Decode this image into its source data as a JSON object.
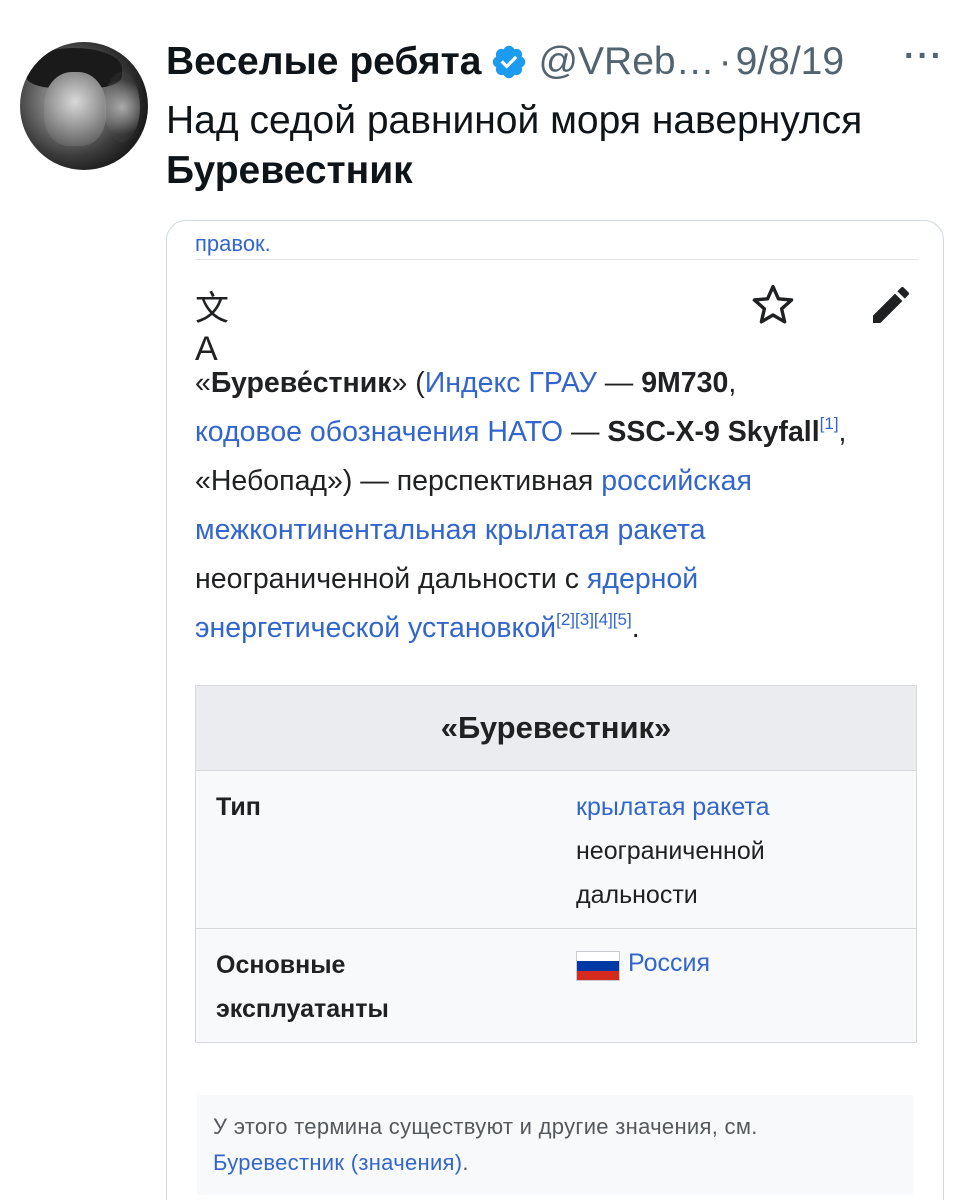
{
  "tweet": {
    "display_name": "Веселые ребята",
    "handle": "@VReb…",
    "separator": "·",
    "date": "9/8/19",
    "more": "···",
    "text_line": "Над седой равниной моря навернулся",
    "text_bold": "Буревестник"
  },
  "wiki": {
    "cut_text": "правок.",
    "translate_glyph": "文A",
    "article": {
      "p1_open": "«",
      "p1_title": "Буреве́стник",
      "p1_close": "» (",
      "gru_link": "Индекс ГРАУ",
      "dash1": " — ",
      "gru_code": "9М730",
      "comma1": ",",
      "nato_link": "кодовое обозначения НАТО",
      "dash2": " — ",
      "nato_code": "SSC-X-9 Skyfall",
      "ref1": "[1]",
      "comma2": ",",
      "alt_name": "«Небопад») — перспективная ",
      "russian_link": "российская",
      "icbm_link": "межконтинентальная крылатая ракета",
      "range_text": "неограниченной дальности с ",
      "nuclear_link_1": "ядерной",
      "nuclear_link_2": "энергетической установкой",
      "refs": "[2][3][4][5]",
      "period": "."
    },
    "infobox": {
      "title": "«Буревестник»",
      "type_label": "Тип",
      "type_value_link": "крылатая ракета",
      "type_value_line2": "неограниченной",
      "type_value_line3": "дальности",
      "operators_label_1": "Основные",
      "operators_label_2": "эксплуатанты",
      "operators_value": "Россия"
    },
    "hatnote": {
      "text": "У этого термина существуют и другие значения, см.",
      "link": "Буревестник (значения)",
      "period": "."
    }
  },
  "colors": {
    "link": "#3366cc",
    "verified": "#1d9bf0",
    "muted": "#536471",
    "flag_white": "#ffffff",
    "flag_blue": "#0039a6",
    "flag_red": "#d52b1e"
  }
}
